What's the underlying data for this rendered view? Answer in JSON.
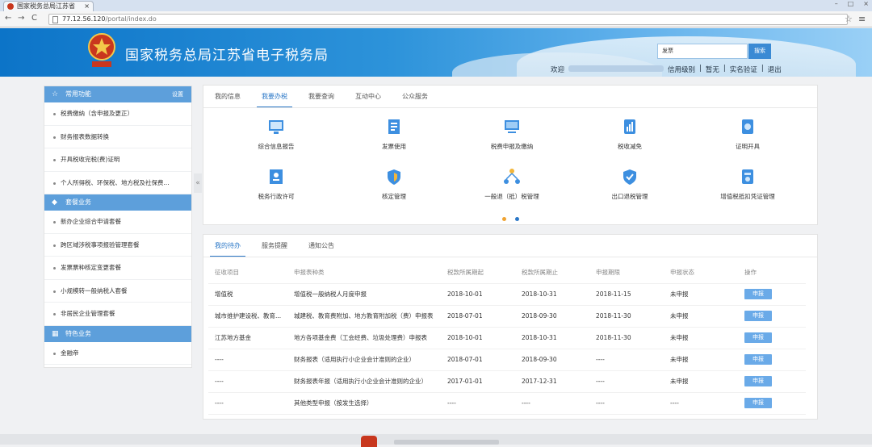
{
  "browser": {
    "tab_title": "国家税务总局江苏省",
    "url_host": "77.12.56.120",
    "url_path": "/portal/index.do"
  },
  "header": {
    "site_title": "国家税务总局江苏省电子税务局",
    "search_placeholder": "发票",
    "search_button": "搜索",
    "welcome": "欢迎",
    "links": [
      "信用级别",
      "暂无",
      "实名验证",
      "退出"
    ]
  },
  "sidebar": {
    "sections": [
      {
        "title": "常用功能",
        "action": "设置",
        "items": [
          "税费缴纳（含申报及更正）",
          "财务报表数据转换",
          "开具税收完税(费)证明",
          "个人所得税、环保税、地方税及社保费..."
        ]
      },
      {
        "title": "套餐业务",
        "items": [
          "新办企业综合申请套餐",
          "跨区域涉税事项报验管理套餐",
          "发票票种核定变更套餐",
          "小规模转一般纳税人套餐",
          "非居民企业管理套餐"
        ]
      },
      {
        "title": "特色业务",
        "items": [
          "金融帝"
        ]
      }
    ]
  },
  "services": {
    "tabs": [
      "我的信息",
      "我要办税",
      "我要查询",
      "互动中心",
      "公众服务"
    ],
    "active_tab": "我要办税",
    "items": [
      "综合信息报告",
      "发票使用",
      "税费申报及缴纳",
      "税收减免",
      "证明开具",
      "税务行政许可",
      "核定管理",
      "一般退（抵）税管理",
      "出口退税管理",
      "增值税抵扣凭证管理"
    ]
  },
  "todo": {
    "tabs": [
      "我的待办",
      "服务提醒",
      "通知公告"
    ],
    "active_tab": "我的待办",
    "columns": [
      "征收项目",
      "申报表种类",
      "税款所属期起",
      "税款所属期止",
      "申报期限",
      "申报状态",
      "操作"
    ],
    "rows": [
      [
        "增值税",
        "增值税一般纳税人月度申报",
        "2018-10-01",
        "2018-10-31",
        "2018-11-15",
        "未申报",
        "申报"
      ],
      [
        "城市维护建设税、教育...",
        "城建税、教育费附加、地方教育附加税（费）申报表",
        "2018-07-01",
        "2018-09-30",
        "2018-11-30",
        "未申报",
        "申报"
      ],
      [
        "江苏地方基金",
        "地方各项基金费（工会经费、垃圾处理费）申报表",
        "2018-10-01",
        "2018-10-31",
        "2018-11-30",
        "未申报",
        "申报"
      ],
      [
        "----",
        "财务报表（适用执行小企业会计准则的企业）",
        "2018-07-01",
        "2018-09-30",
        "----",
        "未申报",
        "申报"
      ],
      [
        "----",
        "财务报表年报（适用执行小企业会计准则的企业）",
        "2017-01-01",
        "2017-12-31",
        "----",
        "未申报",
        "申报"
      ],
      [
        "----",
        "其他类型申报（按发生选择）",
        "----",
        "----",
        "----",
        "----",
        "申报"
      ]
    ]
  }
}
